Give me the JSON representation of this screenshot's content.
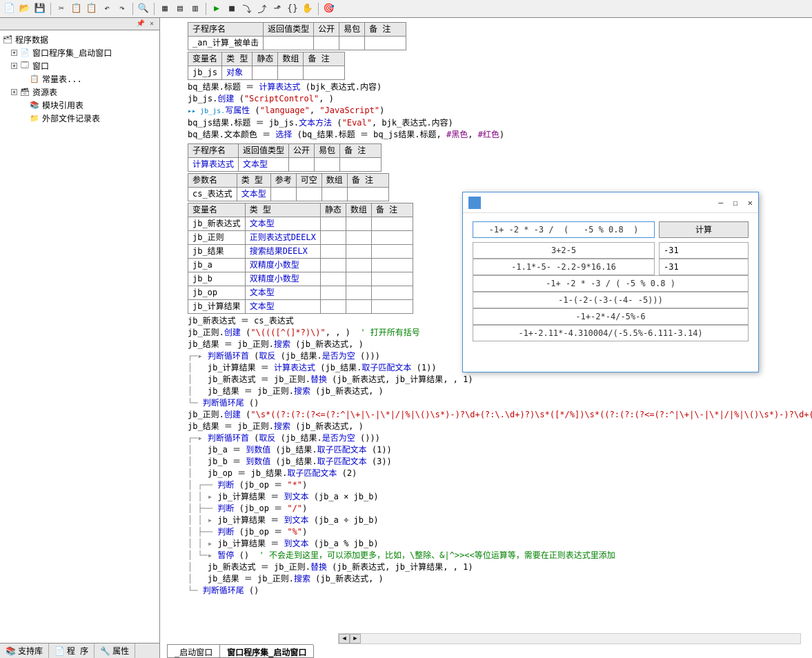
{
  "toolbar": {
    "icons": [
      "new",
      "open",
      "save",
      "cut",
      "copy",
      "paste",
      "undo",
      "redo",
      "find",
      "pane1",
      "pane2",
      "pane3",
      "run",
      "stop",
      "step",
      "stepover",
      "stepout",
      "watch",
      "hand",
      "target"
    ]
  },
  "sidebar": {
    "title": "程序数据",
    "items": [
      {
        "exp": "⊞",
        "label": "窗口程序集_启动窗口",
        "ico": "📄"
      },
      {
        "exp": "⊞",
        "label": "窗口",
        "ico": "🗔"
      },
      {
        "exp": "",
        "label": "常量表...",
        "ico": "📋",
        "sub": true
      },
      {
        "exp": "⊞",
        "label": "资源表",
        "ico": "🗃"
      },
      {
        "exp": "",
        "label": "模块引用表",
        "ico": "📚",
        "sub": true
      },
      {
        "exp": "",
        "label": "外部文件记录表",
        "ico": "📁",
        "sub": true
      }
    ],
    "tabs": [
      "支持库",
      "程 序",
      "属性"
    ]
  },
  "tables": {
    "t1": {
      "hdr": [
        "子程序名",
        "返回值类型",
        "公开",
        "易包",
        "备 注"
      ],
      "row": [
        "_an_计算_被单击",
        "",
        "",
        "",
        ""
      ]
    },
    "t2": {
      "hdr": [
        "变量名",
        "类 型",
        "静态",
        "数组",
        "备 注"
      ],
      "row": [
        "jb_js",
        "对象",
        "",
        "",
        ""
      ]
    },
    "t3": {
      "hdr": [
        "子程序名",
        "返回值类型",
        "公开",
        "易包",
        "备 注"
      ],
      "row": [
        "计算表达式",
        "文本型",
        "",
        "",
        ""
      ]
    },
    "t3b": {
      "hdr": [
        "参数名",
        "类 型",
        "参考",
        "可空",
        "数组",
        "备 注"
      ],
      "row": [
        "cs_表达式",
        "文本型",
        "",
        "",
        "",
        ""
      ]
    },
    "t4": {
      "hdr": [
        "变量名",
        "类 型",
        "静态",
        "数组",
        "备 注"
      ],
      "rows": [
        [
          "jb_新表达式",
          "文本型",
          "",
          "",
          ""
        ],
        [
          "jb_正则",
          "正则表达式DEELX",
          "",
          "",
          ""
        ],
        [
          "jb_结果",
          "搜索结果DEELX",
          "",
          "",
          ""
        ],
        [
          "jb_a",
          "双精度小数型",
          "",
          "",
          ""
        ],
        [
          "jb_b",
          "双精度小数型",
          "",
          "",
          ""
        ],
        [
          "jb_op",
          "文本型",
          "",
          "",
          ""
        ],
        [
          "jb_计算结果",
          "文本型",
          "",
          "",
          ""
        ]
      ]
    }
  },
  "code": {
    "l1a": "bq_结果.标题 ＝ ",
    "l1b": "计算表达式",
    "l1c": " (bjk_表达式.内容)",
    "l2a": "jb_js.",
    "l2b": "创建",
    "l2c": " (",
    "l2d": "\"ScriptControl\"",
    "l2e": ", )",
    "l3a": "▸▸ jb_js.",
    "l3b": "写属性",
    "l3c": " (",
    "l3d": "\"language\"",
    "l3e": ", ",
    "l3f": "\"JavaScript\"",
    "l3g": ")",
    "l4a": "bq_js结果.标题 ＝ jb_js.",
    "l4b": "文本方法",
    "l4c": " (",
    "l4d": "\"Eval\"",
    "l4e": ", bjk_表达式.内容)",
    "l5a": "bq_结果.文本颜色 ＝ ",
    "l5b": "选择",
    "l5c": " (bq_结果.标题 ＝ bq_js结果.标题, ",
    "l5d": "#黑色",
    "l5e": ", ",
    "l5f": "#红色",
    "l5g": ")",
    "l6": "jb_新表达式 ＝ cs_表达式",
    "l7a": "jb_正则.",
    "l7b": "创建",
    "l7c": " (",
    "l7d": "\"\\((([^(]*?)\\)\"",
    "l7e": ", , )  ",
    "l7f": "' 打开所有括号",
    "l8a": "jb_结果 ＝ jb_正则.",
    "l8b": "搜索",
    "l8c": " (jb_新表达式, )",
    "l9a": "判断循环首",
    "l9b": " (",
    "l9c": "取反",
    "l9d": " (jb_结果.",
    "l9e": "是否为空",
    "l9f": " ()))",
    "l10a": "jb_计算结果 ＝ ",
    "l10b": "计算表达式",
    "l10c": " (jb_结果.",
    "l10d": "取子匹配文本",
    "l10e": " (1))",
    "l11a": "jb_新表达式 ＝ jb_正则.",
    "l11b": "替换",
    "l11c": " (jb_新表达式, jb_计算结果, , 1)",
    "l12a": "jb_结果 ＝ jb_正则.",
    "l12b": "搜索",
    "l12c": " (jb_新表达式, )",
    "l13": "判断循环尾",
    "l13b": " ()",
    "l14a": "jb_正则.",
    "l14b": "创建",
    "l14c": " (",
    "l14d": "\"\\s*((?:(?:(?<=(?:^|\\+|\\-|\\*|/|%|\\()\\s*)-)?\\d+(?:\\.\\d+)?)\\s*([*/%])\\s*((?:(?:(?<=(?:^|\\+|\\-|\\*|/|%|\\()\\s*)-)?\\d+(?:\\.\\d+)?)\\s*\"",
    "l14e": ", , )",
    "l15a": "jb_结果 ＝ jb_正则.",
    "l15b": "搜索",
    "l15c": " (jb_新表达式, )",
    "l16a": "判断循环首",
    "l16b": " (",
    "l16c": "取反",
    "l16d": " (jb_结果.",
    "l16e": "是否为空",
    "l16f": " ()))",
    "l17a": "jb_a ＝ ",
    "l17b": "到数值",
    "l17c": " (jb_结果.",
    "l17d": "取子匹配文本",
    "l17e": " (1))",
    "l18a": "jb_b ＝ ",
    "l18b": "到数值",
    "l18c": " (jb_结果.",
    "l18d": "取子匹配文本",
    "l18e": " (3))",
    "l19a": "jb_op ＝ jb_结果.",
    "l19b": "取子匹配文本",
    "l19c": " (2)",
    "l20a": "判断",
    "l20b": " (jb_op ＝ ",
    "l20c": "\"*\"",
    "l20d": ")",
    "l21a": "jb_计算结果 ＝ ",
    "l21b": "到文本",
    "l21c": " (jb_a × jb_b)",
    "l22a": "判断",
    "l22b": " (jb_op ＝ ",
    "l22c": "\"/\"",
    "l22d": ")",
    "l23a": "jb_计算结果 ＝ ",
    "l23b": "到文本",
    "l23c": " (jb_a ÷ jb_b)",
    "l24a": "判断",
    "l24b": " (jb_op ＝ ",
    "l24c": "\"%\"",
    "l24d": ")",
    "l25a": "jb_计算结果 ＝ ",
    "l25b": "到文本",
    "l25c": " (jb_a % jb_b)",
    "l26a": "暂停",
    "l26b": " ()  ",
    "l26c": "' 不会走到这里，可以添加更多，比如，\\整除、&|^>><<等位运算等，需要在正则表达式里添加",
    "l27a": "jb_新表达式 ＝ jb_正则.",
    "l27b": "替换",
    "l27c": " (jb_新表达式, jb_计算结果, , 1)",
    "l28a": "jb_结果 ＝ jb_正则.",
    "l28b": "搜索",
    "l28c": " (jb_新表达式, )",
    "l29": "判断循环尾",
    "l29b": " ()"
  },
  "bottom_tabs": [
    "_启动窗口",
    "窗口程序集_启动窗口"
  ],
  "popup": {
    "input": "-1+ -2 * -3 /  (   -5 % 0.8  )",
    "calc_btn": "计算",
    "rows": [
      {
        "expr": "3+2-5",
        "res": "-31"
      },
      {
        "expr": "-1.1*-5- -2.2-9*16.16",
        "res": "-31"
      },
      {
        "expr": "-1+ -2 * -3 /  (   -5 % 0.8  )",
        "res": ""
      },
      {
        "expr": "-1-(-2-(-3-(-4- -5)))",
        "res": ""
      },
      {
        "expr": "-1+-2*-4/-5%-6",
        "res": ""
      },
      {
        "expr": "-1+-2.11*-4.310004/(-5.5%-6.111-3.14)",
        "res": ""
      }
    ]
  }
}
